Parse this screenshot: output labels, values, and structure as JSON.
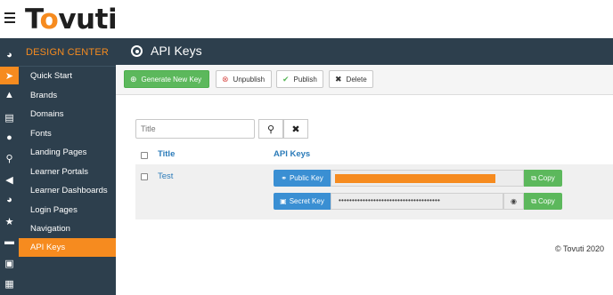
{
  "brand": {
    "logo_text_pre": "T",
    "logo_o": "o",
    "logo_text_post": "vuti"
  },
  "sidebar": {
    "heading": "DESIGN CENTER",
    "items": [
      {
        "label": "Quick Start"
      },
      {
        "label": "Brands"
      },
      {
        "label": "Domains"
      },
      {
        "label": "Fonts"
      },
      {
        "label": "Landing Pages"
      },
      {
        "label": "Learner Portals"
      },
      {
        "label": "Learner Dashboards"
      },
      {
        "label": "Login Pages"
      },
      {
        "label": "Navigation"
      },
      {
        "label": "API Keys"
      }
    ],
    "active_index": 9
  },
  "rail_icons": [
    "dashboard-icon",
    "rocket-icon",
    "graduation-cap-icon",
    "bar-chart-icon",
    "users-icon",
    "trophy-icon",
    "megaphone-icon",
    "rss-icon",
    "star-icon",
    "credit-card-icon",
    "id-card-icon",
    "calendar-icon"
  ],
  "header": {
    "title": "API Keys"
  },
  "toolbar": {
    "generate_label": "Generate New Key",
    "unpublish_label": "Unpublish",
    "publish_label": "Publish",
    "delete_label": "Delete"
  },
  "search": {
    "placeholder": "Title"
  },
  "table": {
    "columns": [
      "Title",
      "API Keys"
    ],
    "rows": [
      {
        "title": "Test",
        "public_key_label": "Public Key",
        "secret_key_label": "Secret Key",
        "secret_mask": "••••••••••••••••••••••••••••••••••••••",
        "copy_label": "Copy"
      }
    ]
  },
  "footer": {
    "copyright": "© Tovuti 2020"
  },
  "colors": {
    "accent": "#f68b1f",
    "nav_bg": "#2d3f4d",
    "primary": "#3a8fd3",
    "success": "#5cb85c",
    "link": "#2b7bb9"
  }
}
